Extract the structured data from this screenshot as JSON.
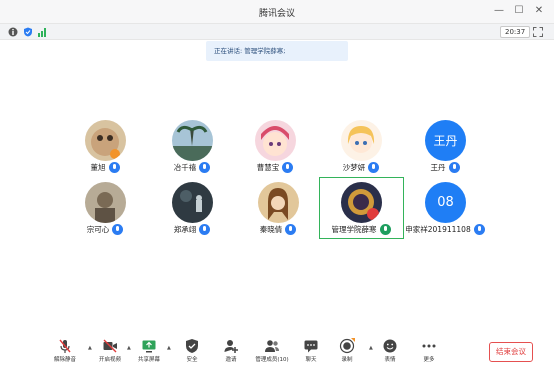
{
  "window": {
    "title": "腾讯会议",
    "controls": {
      "minimize": "—",
      "maximize": "☐",
      "close": "✕"
    }
  },
  "status": {
    "time": "20:37"
  },
  "banner": {
    "text": "正在讲话: 管理学院薛寒;"
  },
  "participants": [
    {
      "name": "董旭",
      "avatar_type": "photo",
      "avatar_color": "#c9a37b"
    },
    {
      "name": "冶千禧",
      "avatar_type": "photo",
      "avatar_color": "#6e8a8a"
    },
    {
      "name": "曹慧宝",
      "avatar_type": "photo",
      "avatar_color": "#e79ab0"
    },
    {
      "name": "沙梦妍",
      "avatar_type": "photo",
      "avatar_color": "#f0c38a"
    },
    {
      "name": "王丹",
      "avatar_type": "text",
      "avatar_text": "王丹"
    },
    {
      "name": "宗可心",
      "avatar_type": "photo",
      "avatar_color": "#8a7f6e"
    },
    {
      "name": "郑承翊",
      "avatar_type": "photo",
      "avatar_color": "#3d4a55"
    },
    {
      "name": "秦晓倩",
      "avatar_type": "photo",
      "avatar_color": "#b88a5c"
    },
    {
      "name": "管理学院薛寒",
      "avatar_type": "photo",
      "avatar_color": "#3a3a52",
      "speaking": true
    },
    {
      "name": "申家祥201911108",
      "avatar_type": "text",
      "avatar_text": "08"
    }
  ],
  "toolbar": {
    "items": [
      {
        "label": "解除静音",
        "icon": "microphone-muted-icon"
      },
      {
        "label": "开启视频",
        "icon": "camera-off-icon"
      },
      {
        "label": "共享屏幕",
        "icon": "screen-share-icon"
      },
      {
        "label": "安全",
        "icon": "shield-icon"
      },
      {
        "label": "邀请",
        "icon": "invite-icon"
      },
      {
        "label": "管理成员(10)",
        "icon": "members-icon"
      },
      {
        "label": "聊天",
        "icon": "chat-icon"
      },
      {
        "label": "录制",
        "icon": "record-icon"
      },
      {
        "label": "表情",
        "icon": "emoji-icon"
      },
      {
        "label": "更多",
        "icon": "more-icon"
      }
    ],
    "end_label": "结束会议"
  },
  "colors": {
    "accent": "#1f7ef5",
    "speaking": "#33b35a",
    "danger": "#e03c3c"
  }
}
